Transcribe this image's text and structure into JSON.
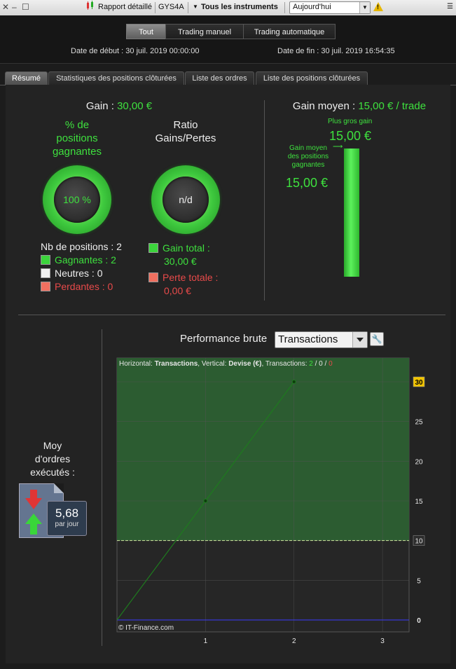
{
  "window": {
    "report_label": "Rapport détaillé",
    "account": "GYS4A",
    "instruments_label": "Tous les instruments",
    "period_value": "Aujourd'hui"
  },
  "modes": [
    "Tout",
    "Trading manuel",
    "Trading automatique"
  ],
  "dates": {
    "start": "Date de début :  30 juil. 2019 00:00:00",
    "end": "Date de fin :  30 juil. 2019 16:54:35"
  },
  "tabs": [
    "Résumé",
    "Statistiques des positions clôturées",
    "Liste des ordres",
    "Liste des positions clôturées"
  ],
  "summary": {
    "gain_label": "Gain : ",
    "gain_value": "30,00 €",
    "pct_title_1": "% de",
    "pct_title_2": "positions",
    "pct_title_3": "gagnantes",
    "pct_value": "100 %",
    "ratio_title_1": "Ratio",
    "ratio_title_2": "Gains/Pertes",
    "ratio_value": "n/d",
    "nb_positions": "Nb de positions : 2",
    "winners": "Gagnantes : 2",
    "neutral": "Neutres : 0",
    "losers": "Perdantes : 0",
    "total_gain_1": "Gain total :",
    "total_gain_2": "30,00 €",
    "total_loss_1": "Perte totale :",
    "total_loss_2": "0,00 €",
    "avg_gain_label": "Gain moyen : ",
    "avg_gain_value": "15,00 € / trade",
    "best_gain_label": "Plus gros gain",
    "best_gain_value": "15,00 €",
    "avg_win_label_1": "Gain moyen",
    "avg_win_label_2": "des positions",
    "avg_win_label_3": "gagnantes",
    "avg_win_value": "15,00 €",
    "avg_win_bar_fraction": 1.0
  },
  "orders": {
    "title_1": "Moy",
    "title_2": "d'ordres",
    "title_3": "exécutés :",
    "rate": "5,68",
    "unit": "par jour"
  },
  "performance": {
    "label": "Performance brute",
    "mode_value": "Transactions",
    "info_prefix": "Horizontal: ",
    "info_h": "Transactions",
    "info_mid": ", Vertical: ",
    "info_v": "Devise (€)",
    "info_tx": ", Transactions: ",
    "info_w": "2",
    "info_s1": " / ",
    "info_n": "0",
    "info_s2": " / ",
    "info_l": "0",
    "copyright": "© IT-Finance.com"
  },
  "chart_data": {
    "type": "line",
    "x": [
      0,
      1,
      2
    ],
    "y": [
      0,
      15,
      30
    ],
    "xticks": [
      1,
      2,
      3
    ],
    "yticks": [
      0,
      5,
      10,
      15,
      20,
      25,
      30
    ],
    "xlim": [
      0,
      3.3
    ],
    "ylim": [
      -1.5,
      33
    ],
    "reference_line": 10,
    "zero_line": 0,
    "highlighted_ticks": [
      30,
      10
    ],
    "colors": {
      "line": "#1e7a1e",
      "area": "#2c5c31",
      "zero": "#3a3aff",
      "ref": "#cfe8a0"
    }
  }
}
